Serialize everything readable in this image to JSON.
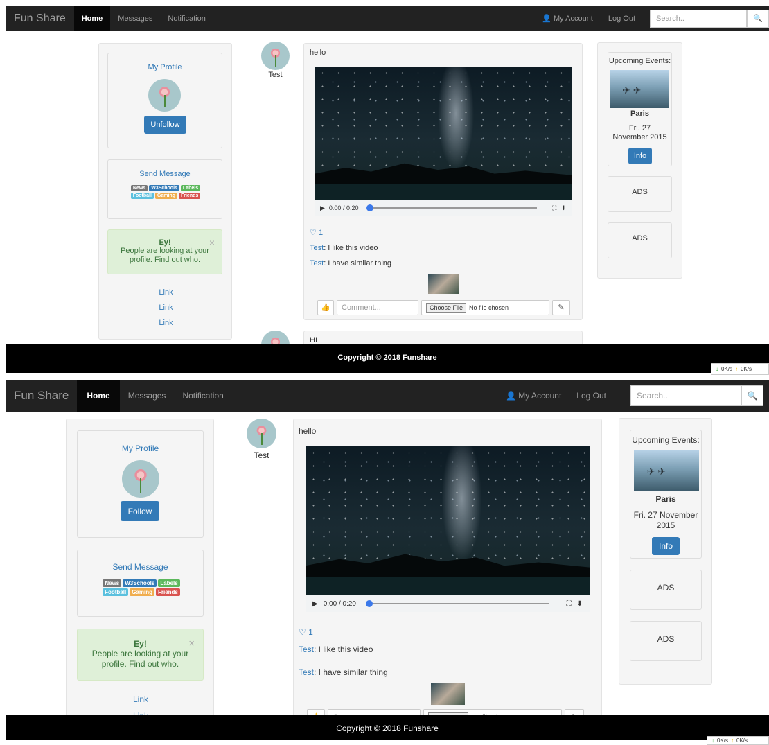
{
  "nav": {
    "brand": "Fun Share",
    "home": "Home",
    "messages": "Messages",
    "notification": "Notification",
    "account": "My Account",
    "logout": "Log Out",
    "search_placeholder": "Search.."
  },
  "shot_a": {
    "profile": {
      "title": "My Profile",
      "button": "Unfollow"
    },
    "links": [
      "Link",
      "Link",
      "Link"
    ],
    "next_post_text": "HI"
  },
  "shot_b": {
    "profile": {
      "title": "My Profile",
      "button": "Follow"
    },
    "links": [
      "Link",
      "Link"
    ]
  },
  "send_message": "Send Message",
  "labels": [
    {
      "text": "News",
      "color": "#777777"
    },
    {
      "text": "W3Schools",
      "color": "#337ab7"
    },
    {
      "text": "Labels",
      "color": "#5cb85c"
    },
    {
      "text": "Football",
      "color": "#5bc0de"
    },
    {
      "text": "Gaming",
      "color": "#f0ad4e"
    },
    {
      "text": "Friends",
      "color": "#d9534f"
    }
  ],
  "alert": {
    "title": "Ey!",
    "body": "People are looking at your profile. Find out who.",
    "close": "×"
  },
  "post": {
    "author": "Test",
    "text": "hello",
    "video_time": "0:00 / 0:20",
    "likes": "1",
    "comments": [
      {
        "user": "Test",
        "text": ": I like this video"
      },
      {
        "user": "Test",
        "text": ": I have similar thing"
      }
    ],
    "comment_placeholder": "Comment...",
    "choose_file": "Choose File",
    "no_file": "No file chosen"
  },
  "events": {
    "title": "Upcoming Events:",
    "city": "Paris",
    "date": "Fri. 27 November 2015",
    "button": "Info"
  },
  "ads": [
    "ADS",
    "ADS"
  ],
  "footer": "Copyright © 2018 Funshare",
  "speed": {
    "down": "0K/s",
    "up": "0K/s"
  },
  "colors": {
    "navbar": "#222222",
    "primary": "#337ab7",
    "alert_bg": "#dff0d8"
  }
}
